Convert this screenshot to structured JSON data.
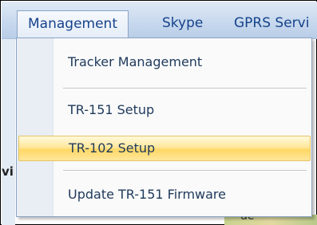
{
  "menubar": {
    "items": [
      {
        "label": "Management"
      },
      {
        "label": "Skype"
      },
      {
        "label": "GPRS Servi"
      }
    ]
  },
  "dropdown": {
    "items": [
      {
        "label": "Tracker Management"
      },
      {
        "label": "TR-151 Setup"
      },
      {
        "label": "TR-102 Setup"
      },
      {
        "label": "Update TR-151 Firmware"
      }
    ]
  },
  "background": {
    "left_fragment": "vi",
    "map_fragment": "de"
  }
}
